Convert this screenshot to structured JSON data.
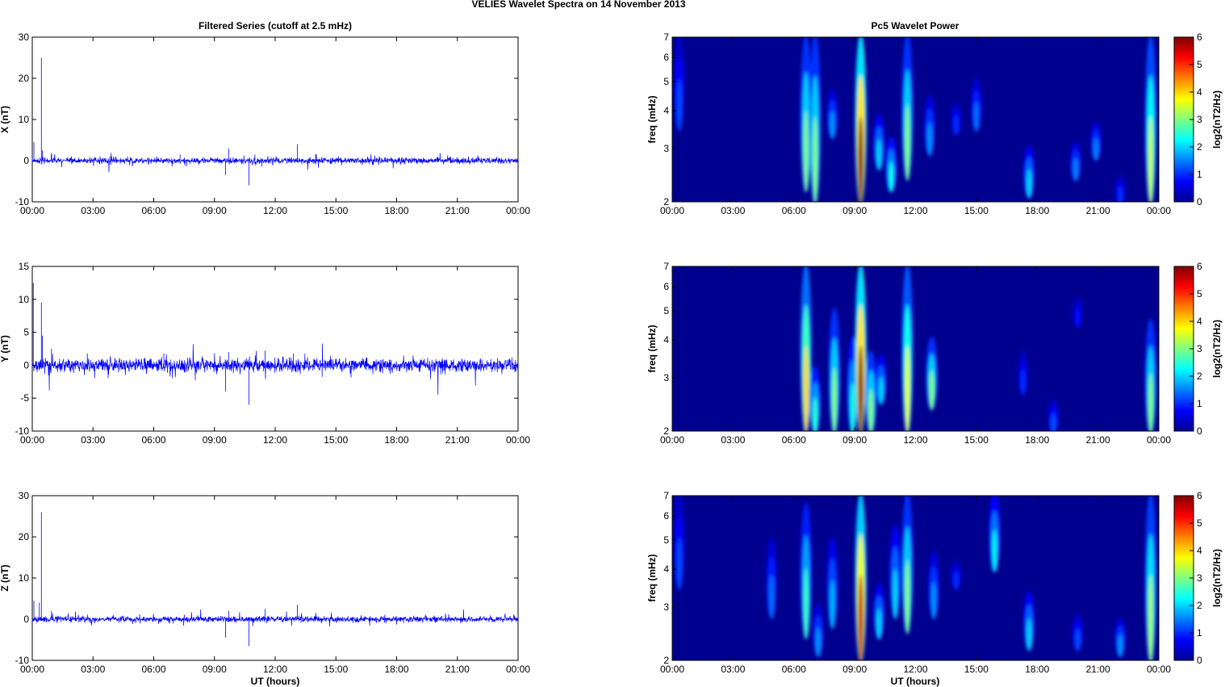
{
  "chart_data": {
    "title": "VELIES Wavelet Spectra on 14 November  2013",
    "left_title": "Filtered Series (cutoff at 2.5 mHz)",
    "right_title": "Pc5 Wavelet Power",
    "xlabel": "UT (hours)",
    "xticks": [
      "00:00",
      "03:00",
      "06:00",
      "09:00",
      "12:00",
      "15:00",
      "18:00",
      "21:00",
      "00:00"
    ],
    "xlim": [
      0,
      24
    ],
    "series": [
      {
        "type": "line",
        "name": "X",
        "ylabel": "X (nT)",
        "ylim": [
          -10,
          30
        ],
        "yticks": [
          "30",
          "20",
          "10",
          "0",
          "-10"
        ],
        "color": "#0000ff",
        "noise_std": 0.35,
        "spikes": [
          [
            0.08,
            4.5
          ],
          [
            0.45,
            25
          ],
          [
            0.5,
            2.5
          ],
          [
            0.95,
            1.5
          ],
          [
            7.3,
            1.5
          ],
          [
            9.55,
            -3.5
          ],
          [
            9.7,
            3
          ],
          [
            10.7,
            -6
          ],
          [
            11.0,
            1.5
          ],
          [
            13.1,
            4
          ],
          [
            14.0,
            1.5
          ]
        ]
      },
      {
        "type": "line",
        "name": "Y",
        "ylabel": "Y (nT)",
        "ylim": [
          -10,
          15
        ],
        "yticks": [
          "15",
          "10",
          "5",
          "0",
          "-5",
          "-10"
        ],
        "color": "#0000ff",
        "noise_std": 0.5,
        "spikes": [
          [
            0.05,
            12.5
          ],
          [
            0.45,
            9.5
          ],
          [
            0.5,
            4.5
          ],
          [
            0.95,
            2.5
          ],
          [
            6.5,
            1.8
          ],
          [
            9.55,
            -4
          ],
          [
            9.7,
            2
          ],
          [
            10.7,
            -6
          ],
          [
            11.5,
            2.2
          ],
          [
            12.9,
            1.8
          ]
        ]
      },
      {
        "type": "line",
        "name": "Z",
        "ylabel": "Z (nT)",
        "ylim": [
          -10,
          30
        ],
        "yticks": [
          "30",
          "20",
          "10",
          "0",
          "-10"
        ],
        "color": "#0000ff",
        "noise_std": 0.35,
        "spikes": [
          [
            0.08,
            4.5
          ],
          [
            0.35,
            4
          ],
          [
            0.45,
            26
          ],
          [
            0.95,
            2
          ],
          [
            9.55,
            -4.5
          ],
          [
            9.7,
            2
          ],
          [
            10.7,
            -6.5
          ],
          [
            11.5,
            2.5
          ],
          [
            13.1,
            3.5
          ]
        ]
      }
    ],
    "spectra": [
      {
        "type": "heatmap",
        "ylabel": "freq (mHz)",
        "ylim": [
          2,
          7
        ],
        "yticks": [
          "7",
          "6",
          "5",
          "4",
          "3",
          "2"
        ],
        "clim": [
          0,
          6
        ],
        "cbar_label": "log2(nT2/Hz)",
        "cbar_ticks": [
          "6",
          "5",
          "4",
          "3",
          "2",
          "1",
          "0"
        ],
        "streaks": [
          [
            0.35,
            3.5,
            7,
            1.2
          ],
          [
            6.6,
            2.2,
            7,
            3
          ],
          [
            7.05,
            2,
            7,
            3
          ],
          [
            7.9,
            3.3,
            4.6,
            1.6
          ],
          [
            9.3,
            2,
            7,
            6
          ],
          [
            10.2,
            2.6,
            3.8,
            2
          ],
          [
            10.8,
            2.2,
            3.2,
            2.3
          ],
          [
            11.6,
            2.4,
            7,
            3
          ],
          [
            12.7,
            2.9,
            4.4,
            1.6
          ],
          [
            14.0,
            3.4,
            4.2,
            1
          ],
          [
            15.0,
            3.5,
            5,
            1.4
          ],
          [
            17.6,
            2.1,
            3,
            2
          ],
          [
            19.9,
            2.4,
            3.1,
            1.5
          ],
          [
            20.9,
            2.8,
            3.6,
            1.5
          ],
          [
            22.1,
            2,
            2.4,
            1
          ],
          [
            23.6,
            2,
            7,
            3.4
          ]
        ]
      },
      {
        "type": "heatmap",
        "ylabel": "freq (mHz)",
        "ylim": [
          2,
          7
        ],
        "yticks": [
          "7",
          "6",
          "5",
          "4",
          "3",
          "2"
        ],
        "clim": [
          0,
          6
        ],
        "cbar_label": "log2(nT2/Hz)",
        "cbar_ticks": [
          "6",
          "5",
          "4",
          "3",
          "2",
          "1",
          "0"
        ],
        "streaks": [
          [
            6.6,
            2,
            7,
            4
          ],
          [
            7.05,
            2,
            3.2,
            2.5
          ],
          [
            8.0,
            2,
            5,
            3
          ],
          [
            8.9,
            2,
            4,
            2.4
          ],
          [
            9.3,
            2,
            7,
            6
          ],
          [
            9.8,
            2,
            3.6,
            3
          ],
          [
            10.3,
            2.5,
            3.5,
            2
          ],
          [
            11.6,
            2,
            7,
            3.6
          ],
          [
            12.8,
            2.4,
            4,
            3
          ],
          [
            17.3,
            2.7,
            3.6,
            1
          ],
          [
            18.8,
            2,
            2.5,
            1.2
          ],
          [
            20.0,
            4.5,
            5.5,
            0.8
          ],
          [
            23.6,
            2,
            4.6,
            3
          ]
        ]
      },
      {
        "type": "heatmap",
        "ylabel": "freq (mHz)",
        "ylim": [
          2,
          7
        ],
        "yticks": [
          "7",
          "6",
          "5",
          "4",
          "3",
          "2"
        ],
        "clim": [
          0,
          6
        ],
        "cbar_label": "log2(nT2/Hz)",
        "cbar_ticks": [
          "6",
          "5",
          "4",
          "3",
          "2",
          "1",
          "0"
        ],
        "streaks": [
          [
            0.35,
            3.5,
            7,
            1.2
          ],
          [
            4.9,
            2.8,
            5,
            1.4
          ],
          [
            6.6,
            2.4,
            6.5,
            2.6
          ],
          [
            7.2,
            2.1,
            3,
            1.6
          ],
          [
            7.9,
            2.6,
            5,
            1.8
          ],
          [
            9.3,
            2,
            7,
            5.6
          ],
          [
            10.2,
            2.4,
            3.5,
            2
          ],
          [
            11.0,
            2.8,
            5.5,
            2
          ],
          [
            11.6,
            2.5,
            7,
            3
          ],
          [
            12.9,
            2.8,
            4.5,
            1.6
          ],
          [
            14.0,
            3.5,
            4.2,
            1
          ],
          [
            15.9,
            4,
            7,
            2.2
          ],
          [
            17.6,
            2.2,
            3.3,
            2
          ],
          [
            20.0,
            2.2,
            2.8,
            1.2
          ],
          [
            22.1,
            2.1,
            2.7,
            1.6
          ],
          [
            23.6,
            2,
            7,
            3.2
          ]
        ]
      }
    ]
  }
}
